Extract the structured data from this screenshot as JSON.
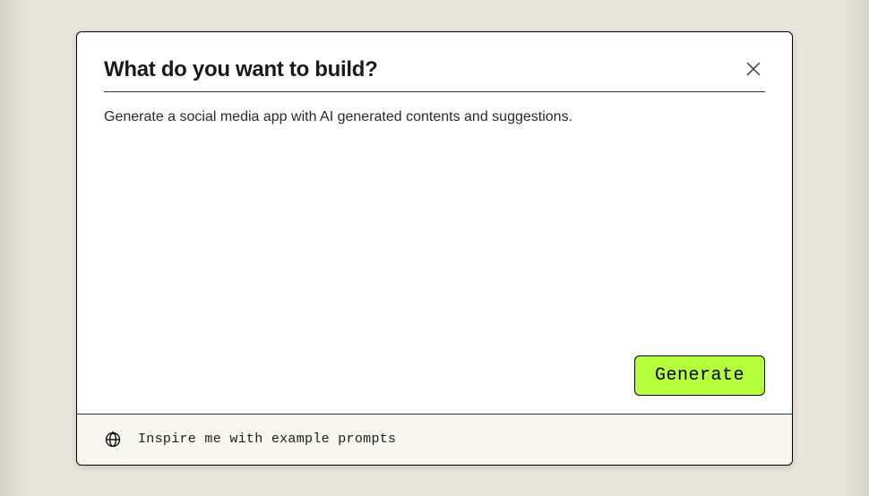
{
  "modal": {
    "title": "What do you want to build?",
    "prompt_value": "Generate a social media app with AI generated contents and suggestions.",
    "generate_label": "Generate"
  },
  "footer": {
    "inspire_label": "Inspire me with example prompts"
  }
}
